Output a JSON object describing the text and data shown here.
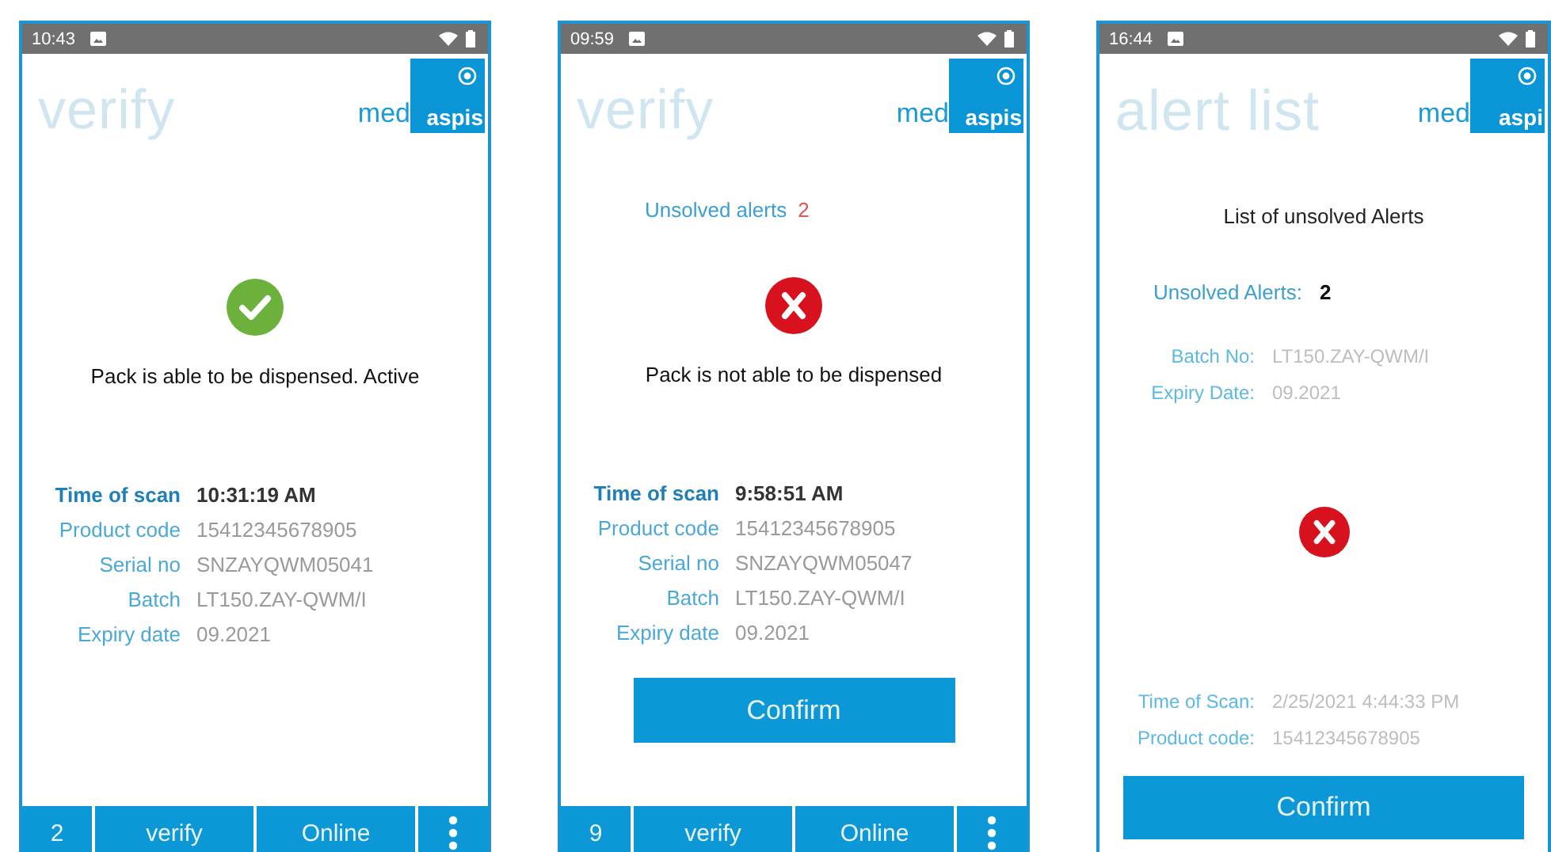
{
  "screens": [
    {
      "kind": "result",
      "status_time": "10:43",
      "title": "verify",
      "logo": {
        "left": "med",
        "right": "aspis"
      },
      "blocks": [
        {
          "kind": "pass_status",
          "message": "Pack is able to be dispensed. Active"
        },
        {
          "kind": "details",
          "rows": [
            {
              "label": "Time of scan",
              "value": "10:31:19 AM",
              "bold": true
            },
            {
              "label": "Product code",
              "value": "15412345678905",
              "bold": false
            },
            {
              "label": "Serial no",
              "value": "SNZAYQWM05041",
              "bold": false
            },
            {
              "label": "Batch",
              "value": "LT150.ZAY-QWM/I",
              "bold": false
            },
            {
              "label": "Expiry date",
              "value": "09.2021",
              "bold": false
            }
          ]
        }
      ],
      "nav": [
        {
          "kind": "text",
          "label": "2"
        },
        {
          "kind": "text",
          "label": "verify"
        },
        {
          "kind": "text",
          "label": "Online"
        },
        {
          "kind": "menu"
        }
      ]
    },
    {
      "kind": "result",
      "status_time": "09:59",
      "title": "verify",
      "logo": {
        "left": "med",
        "right": "aspis"
      },
      "blocks": [
        {
          "kind": "alerts",
          "label": "Unsolved alerts",
          "count": "2"
        },
        {
          "kind": "fail_status",
          "message": "Pack is not able to be dispensed"
        },
        {
          "kind": "details",
          "rows": [
            {
              "label": "Time of scan",
              "value": "9:58:51 AM",
              "bold": true
            },
            {
              "label": "Product code",
              "value": "15412345678905",
              "bold": false
            },
            {
              "label": "Serial no",
              "value": "SNZAYQWM05047",
              "bold": false
            },
            {
              "label": "Batch",
              "value": "LT150.ZAY-QWM/I",
              "bold": false
            },
            {
              "label": "Expiry date",
              "value": "09.2021",
              "bold": false
            }
          ]
        },
        {
          "kind": "confirm",
          "label": "Confirm"
        }
      ],
      "nav": [
        {
          "kind": "text",
          "label": "9"
        },
        {
          "kind": "text",
          "label": "verify"
        },
        {
          "kind": "text",
          "label": "Online"
        },
        {
          "kind": "menu"
        }
      ]
    },
    {
      "kind": "alert_list",
      "status_time": "16:44",
      "title": "alert list",
      "logo": {
        "left": "med",
        "right": "aspi"
      },
      "blocks": [
        {
          "kind": "heading",
          "text": "List of unsolved Alerts"
        },
        {
          "kind": "alerts",
          "label": "Unsolved Alerts:",
          "count": "2"
        },
        {
          "kind": "details",
          "rows": [
            {
              "label": "Batch No:",
              "value": "LT150.ZAY-QWM/I",
              "bold": false
            },
            {
              "label": "Expiry Date:",
              "value": "09.2021",
              "bold": false
            }
          ]
        },
        {
          "kind": "fail_status"
        },
        {
          "kind": "details",
          "rows": [
            {
              "label": "Time of Scan:",
              "value": "2/25/2021 4:44:33 PM",
              "bold": false
            },
            {
              "label": "Product code:",
              "value": "15412345678905",
              "bold": false
            }
          ]
        },
        {
          "kind": "confirm",
          "label": "Confirm"
        }
      ]
    }
  ]
}
